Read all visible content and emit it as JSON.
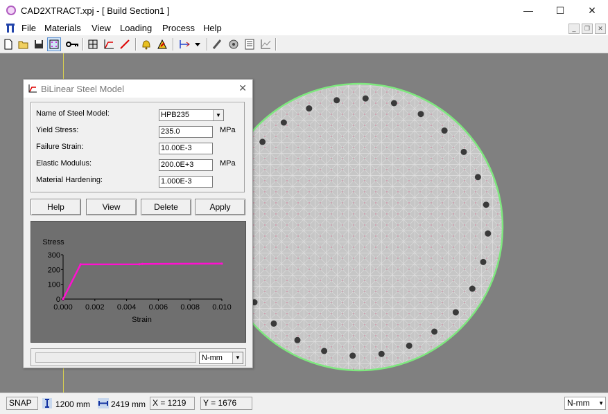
{
  "window": {
    "title": "CAD2XTRACT.xpj - [ Build Section1 ]",
    "minimize": "—",
    "maximize": "☐",
    "close": "✕"
  },
  "menu": [
    "File",
    "Materials",
    "View",
    "Loading",
    "Process",
    "Help"
  ],
  "toolbar": {
    "icons": [
      "new-file-icon",
      "open-folder-icon",
      "save-icon",
      "mesh-grid-icon",
      "key-icon",
      "section-grid-icon",
      "stress-strain-icon",
      "line-draw-icon",
      "bell-icon",
      "analysis-icon",
      "axis-icon",
      "dropdown-arrow-icon",
      "pen-icon",
      "reinforcement-icon",
      "report-icon",
      "chart-icon"
    ]
  },
  "dialog": {
    "title": "BiLinear Steel Model",
    "fields": [
      {
        "label": "Name of Steel Model:",
        "value": "HPB235",
        "unit": ""
      },
      {
        "label": "Yield Stress:",
        "value": "235.0",
        "unit": "MPa"
      },
      {
        "label": "Failure Strain:",
        "value": "10.00E-3",
        "unit": ""
      },
      {
        "label": "Elastic Modulus:",
        "value": "200.0E+3",
        "unit": "MPa"
      },
      {
        "label": "Material Hardening:",
        "value": "1.000E-3",
        "unit": ""
      }
    ],
    "buttons": [
      "Help",
      "View",
      "Delete",
      "Apply"
    ],
    "units": "N-mm"
  },
  "chart_data": {
    "type": "line",
    "title": "",
    "xlabel": "Strain",
    "ylabel": "Stress",
    "xlim": [
      0,
      0.01
    ],
    "ylim": [
      0,
      300
    ],
    "xticks": [
      "0.000",
      "0.002",
      "0.004",
      "0.006",
      "0.008",
      "0.010"
    ],
    "yticks": [
      "0",
      "100",
      "200",
      "300"
    ],
    "series": [
      {
        "x": [
          0,
          0.0011,
          0.0048,
          0.005,
          0.01
        ],
        "y": [
          0,
          235,
          235.5,
          238,
          240
        ],
        "color": "#ff10d0"
      }
    ]
  },
  "status": {
    "snap": "SNAP",
    "height": "1200 mm",
    "width": "2419 mm",
    "x": "X = 1219",
    "y": "Y = 1676",
    "units": "N-mm"
  },
  "colors": {
    "workspace": "#808080",
    "section_fill": "#c6c6c6",
    "section_outline": "#7ee87e",
    "rebar": "#3a3a3a",
    "curve": "#ff10d0"
  }
}
